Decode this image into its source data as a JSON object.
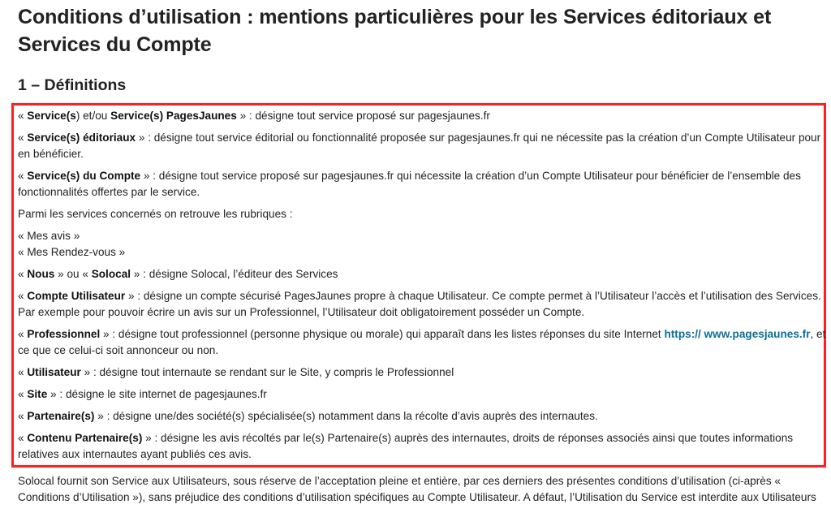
{
  "title": "Conditions d’utilisation : mentions particulières pour les Services éditoriaux et Services du Compte",
  "section_title": "1 – Définitions",
  "highlight_color": "#ff1f1f",
  "link_color": "#0b6e99",
  "definitions": {
    "services": {
      "open": "« ",
      "term1": "Service(s",
      "mid": ") et/ou ",
      "term2": "Service(s) PagesJaunes",
      "rest": " » : désigne tout service proposé sur pagesjaunes.fr"
    },
    "editoriaux": {
      "open": "« ",
      "term": "Service(s) éditoriaux",
      "rest": " » : désigne tout service éditorial ou fonctionnalité proposée sur pagesjaunes.fr qui ne nécessite pas la création d’un Compte Utilisateur pour en bénéficier."
    },
    "compte": {
      "open": "« ",
      "term": "Service(s) du Compte",
      "rest": " » : désigne tout service proposé sur pagesjaunes.fr qui nécessite la création d’un Compte Utilisateur pour bénéficier de l’ensemble des fonctionnalités offertes par le service."
    },
    "rubriques_intro": "Parmi les services concernés on retrouve les rubriques :",
    "rubrique_1": "« Mes avis »",
    "rubrique_2": "« Mes Rendez-vous »",
    "nous": {
      "open": "« ",
      "term1": "Nous",
      "mid": " » ou « ",
      "term2": "Solocal",
      "rest": " » : désigne Solocal, l’éditeur des Services"
    },
    "compte_utilisateur": {
      "open": "« ",
      "term": "Compte Utilisateur",
      "rest": " » : désigne un compte sécurisé PagesJaunes propre à chaque Utilisateur. Ce compte permet à l’Utilisateur l’accès et l’utilisation des Services. Par exemple pour pouvoir écrire un avis sur un Professionnel, l’Utilisateur doit obligatoirement posséder un Compte."
    },
    "professionnel": {
      "open": "« ",
      "term": "Professionnel",
      "rest": " » : désigne tout professionnel (personne physique ou morale) qui apparaît dans les listes réponses du site Internet ",
      "link": "https:// www.pagesjaunes.fr",
      "after": ", et ce que ce celui-ci soit annonceur ou non."
    },
    "utilisateur": {
      "open": "« ",
      "term": "Utilisateur",
      "rest": " » : désigne tout internaute se rendant sur le Site, y compris le Professionnel"
    },
    "site": {
      "open": "« ",
      "term": "Site",
      "rest": " » : désigne le site internet de pagesjaunes.fr"
    },
    "partenaires": {
      "open": "« ",
      "term": "Partenaire(s)",
      "rest": " » : désigne une/des société(s) spécialisée(s) notamment dans la récolte d’avis auprès des internautes."
    },
    "contenu_partenaire": {
      "open": "« ",
      "term": "Contenu Partenaire(s)",
      "rest": " » : désigne les avis récoltés par le(s) Partenaire(s) auprès des internautes, droits de réponses associés ainsi que toutes informations relatives aux internautes ayant publiés ces avis."
    }
  },
  "footer": "Solocal fournit son Service aux Utilisateurs, sous réserve de l’acceptation pleine et entière, par ces derniers des présentes conditions d’utilisation (ci-après « Conditions d’Utilisation »), sans préjudice des conditions d’utilisation spécifiques au Compte Utilisateur. A défaut, l’Utilisation du Service est interdite aux Utilisateurs"
}
